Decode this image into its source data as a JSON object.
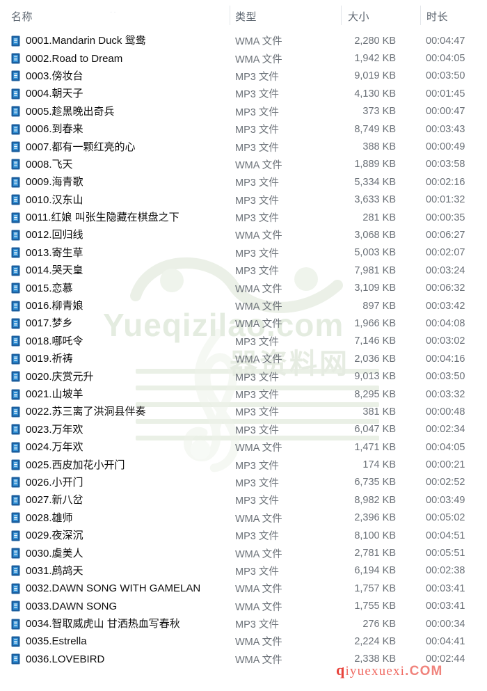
{
  "window": {
    "kind": "file-explorer-details-list"
  },
  "columns": [
    {
      "key": "name",
      "label": "名称"
    },
    {
      "key": "type",
      "label": "类型"
    },
    {
      "key": "size",
      "label": "大小"
    },
    {
      "key": "duration",
      "label": "时长"
    }
  ],
  "watermarks": {
    "site_latin": "Yueqizilao.com",
    "site_cn": "器资料网",
    "overlay_red_prefix": "q",
    "overlay_red_text": "iyuexuexi",
    "overlay_red_suffix": ".COM"
  },
  "colors": {
    "icon_outer": "#1b5e9e",
    "icon_inner": "#2f8fd4",
    "header_text": "#5d6670",
    "name_text": "#0d0d0d",
    "meta_text": "#6b7178",
    "divider": "#e3e6ea",
    "watermark_green": "#e4ece0",
    "watermark_red": "#f06a62",
    "background": "#ffffff"
  },
  "files": [
    {
      "name": "0001.Mandarin Duck 鸳鸯",
      "type": "WMA 文件",
      "size": "2,280 KB",
      "duration": "00:04:47"
    },
    {
      "name": "0002.Road to Dream",
      "type": "WMA 文件",
      "size": "1,942 KB",
      "duration": "00:04:05"
    },
    {
      "name": "0003.傍妆台",
      "type": "MP3 文件",
      "size": "9,019 KB",
      "duration": "00:03:50"
    },
    {
      "name": "0004.朝天子",
      "type": "MP3 文件",
      "size": "4,130 KB",
      "duration": "00:01:45"
    },
    {
      "name": "0005.趁黑晚出奇兵",
      "type": "MP3 文件",
      "size": "373 KB",
      "duration": "00:00:47"
    },
    {
      "name": "0006.到春来",
      "type": "MP3 文件",
      "size": "8,749 KB",
      "duration": "00:03:43"
    },
    {
      "name": "0007.都有一颗红亮的心",
      "type": "MP3 文件",
      "size": "388 KB",
      "duration": "00:00:49"
    },
    {
      "name": "0008.飞天",
      "type": "WMA 文件",
      "size": "1,889 KB",
      "duration": "00:03:58"
    },
    {
      "name": "0009.海青歌",
      "type": "MP3 文件",
      "size": "5,334 KB",
      "duration": "00:02:16"
    },
    {
      "name": "0010.汉东山",
      "type": "MP3 文件",
      "size": "3,633 KB",
      "duration": "00:01:32"
    },
    {
      "name": "0011.红娘 叫张生隐藏在棋盘之下",
      "type": "MP3 文件",
      "size": "281 KB",
      "duration": "00:00:35"
    },
    {
      "name": "0012.回归线",
      "type": "WMA 文件",
      "size": "3,068 KB",
      "duration": "00:06:27"
    },
    {
      "name": "0013.寄生草",
      "type": "MP3 文件",
      "size": "5,003 KB",
      "duration": "00:02:07"
    },
    {
      "name": "0014.哭天皇",
      "type": "MP3 文件",
      "size": "7,981 KB",
      "duration": "00:03:24"
    },
    {
      "name": "0015.恋慕",
      "type": "WMA 文件",
      "size": "3,109 KB",
      "duration": "00:06:32"
    },
    {
      "name": "0016.柳青娘",
      "type": "WMA 文件",
      "size": "897 KB",
      "duration": "00:03:42"
    },
    {
      "name": "0017.梦乡",
      "type": "WMA 文件",
      "size": "1,966 KB",
      "duration": "00:04:08"
    },
    {
      "name": "0018.哪吒令",
      "type": "MP3 文件",
      "size": "7,146 KB",
      "duration": "00:03:02"
    },
    {
      "name": "0019.祈祷",
      "type": "WMA 文件",
      "size": "2,036 KB",
      "duration": "00:04:16"
    },
    {
      "name": "0020.庆赏元升",
      "type": "MP3 文件",
      "size": "9,013 KB",
      "duration": "00:03:50"
    },
    {
      "name": "0021.山坡羊",
      "type": "MP3 文件",
      "size": "8,295 KB",
      "duration": "00:03:32"
    },
    {
      "name": "0022.苏三离了洪洞县伴奏",
      "type": "MP3 文件",
      "size": "381 KB",
      "duration": "00:00:48"
    },
    {
      "name": "0023.万年欢",
      "type": "MP3 文件",
      "size": "6,047 KB",
      "duration": "00:02:34"
    },
    {
      "name": "0024.万年欢",
      "type": "WMA 文件",
      "size": "1,471 KB",
      "duration": "00:04:05"
    },
    {
      "name": "0025.西皮加花小开门",
      "type": "MP3 文件",
      "size": "174 KB",
      "duration": "00:00:21"
    },
    {
      "name": "0026.小开门",
      "type": "MP3 文件",
      "size": "6,735 KB",
      "duration": "00:02:52"
    },
    {
      "name": "0027.新八岔",
      "type": "MP3 文件",
      "size": "8,982 KB",
      "duration": "00:03:49"
    },
    {
      "name": "0028.雄师",
      "type": "WMA 文件",
      "size": "2,396 KB",
      "duration": "00:05:02"
    },
    {
      "name": "0029.夜深沉",
      "type": "MP3 文件",
      "size": "8,100 KB",
      "duration": "00:04:51"
    },
    {
      "name": "0030.虞美人",
      "type": "WMA 文件",
      "size": "2,781 KB",
      "duration": "00:05:51"
    },
    {
      "name": "0031.鹧鸪天",
      "type": "MP3 文件",
      "size": "6,194 KB",
      "duration": "00:02:38"
    },
    {
      "name": "0032.DAWN SONG WITH GAMELAN",
      "type": "WMA 文件",
      "size": "1,757 KB",
      "duration": "00:03:41"
    },
    {
      "name": "0033.DAWN SONG",
      "type": "WMA 文件",
      "size": "1,755 KB",
      "duration": "00:03:41"
    },
    {
      "name": "0034.智取威虎山 甘洒热血写春秋",
      "type": "MP3 文件",
      "size": "276 KB",
      "duration": "00:00:34"
    },
    {
      "name": "0035.Estrella",
      "type": "WMA 文件",
      "size": "2,224 KB",
      "duration": "00:04:41"
    },
    {
      "name": "0036.LOVEBIRD",
      "type": "WMA 文件",
      "size": "2,338 KB",
      "duration": "00:02:44"
    }
  ]
}
